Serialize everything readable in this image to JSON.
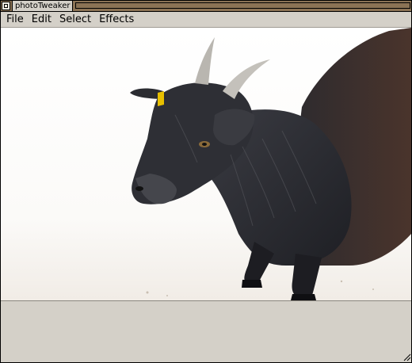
{
  "window": {
    "title": "photoTweaker"
  },
  "menubar": {
    "items": [
      {
        "label": "File",
        "name": "menu-file"
      },
      {
        "label": "Edit",
        "name": "menu-edit"
      },
      {
        "label": "Select",
        "name": "menu-select"
      },
      {
        "label": "Effects",
        "name": "menu-effects"
      }
    ]
  },
  "canvas": {
    "subject": "black goat with horns and yellow ear tag",
    "background": "#ffffff"
  },
  "colors": {
    "titlebar": "#8b7355",
    "chrome": "#d4d0c8",
    "goat": "#2a2b30",
    "ear_tag": "#e8c000"
  }
}
